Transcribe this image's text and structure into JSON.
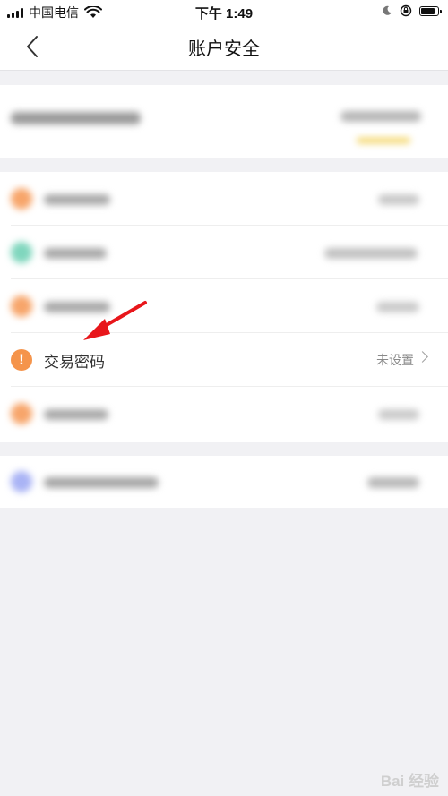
{
  "status_bar": {
    "carrier": "中国电信",
    "time": "下午 1:49"
  },
  "nav": {
    "title": "账户安全"
  },
  "rows": [
    {
      "label": "交易密码",
      "value": "未设置"
    }
  ],
  "colors": {
    "accent": "#f5944b",
    "annotation_arrow": "#e8161b"
  },
  "icons": {
    "back": "chevron-left-icon",
    "warning": "exclamation-circle-icon",
    "chevron": "chevron-right-icon",
    "wifi": "wifi-icon",
    "moon": "moon-icon",
    "orientation_lock": "rotation-lock-icon",
    "battery": "battery-icon"
  },
  "watermark": "Bai 经验"
}
